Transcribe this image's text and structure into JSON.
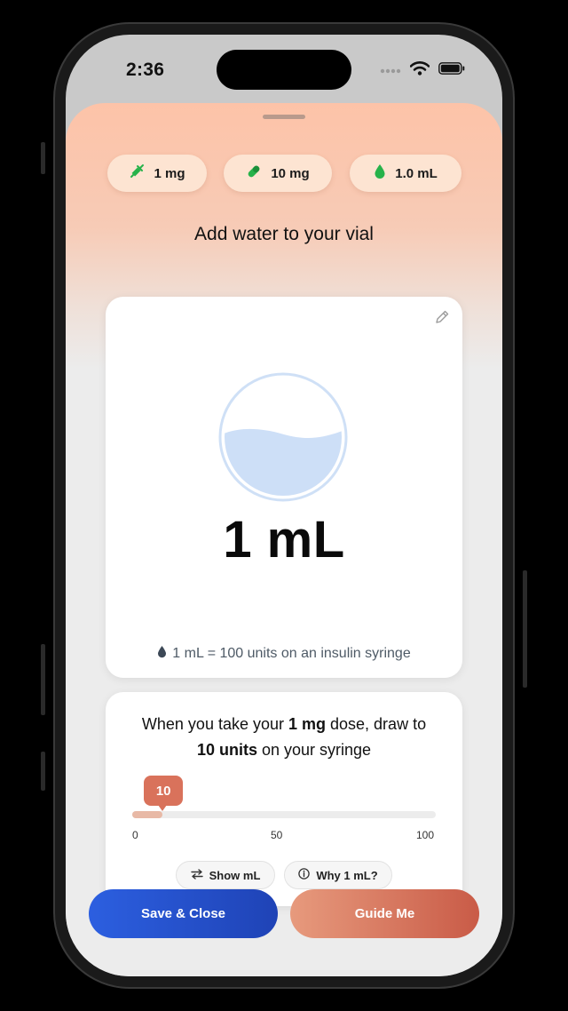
{
  "status_bar": {
    "time": "2:36"
  },
  "pills": [
    {
      "icon": "syringe-icon",
      "label": "1 mg"
    },
    {
      "icon": "pill-icon",
      "label": "10 mg"
    },
    {
      "icon": "drop-icon",
      "label": "1.0 mL"
    }
  ],
  "heading": "Add water to your vial",
  "vial_card": {
    "amount": "1 mL",
    "note": "1 mL = 100 units on an insulin syringe",
    "fill_level": 0.55
  },
  "dose_card": {
    "line1_pre": "When you take your ",
    "line1_bold": "1 mg",
    "line1_post": " dose, draw to",
    "line2_bold": "10 units",
    "line2_post": " on your syringe",
    "slider": {
      "value": 10,
      "value_label": "10",
      "min": 0,
      "max": 100,
      "ticks": [
        "0",
        "50",
        "100"
      ]
    },
    "show_ml": "Show mL",
    "why": "Why 1 mL?"
  },
  "buttons": {
    "save": "Save & Close",
    "guide": "Guide Me"
  },
  "colors": {
    "accent_blue": "#2c5fe0",
    "accent_coral": "#d9725b",
    "pill_green": "#27b24a"
  }
}
